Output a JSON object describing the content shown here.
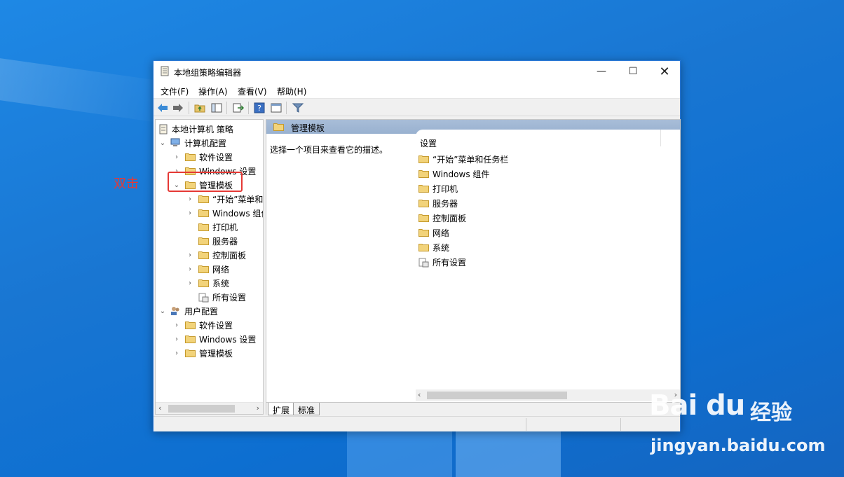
{
  "window": {
    "title": "本地组策略编辑器",
    "controls": {
      "minimize": "—",
      "maximize": "☐",
      "close": "✕"
    }
  },
  "menu": [
    "文件(F)",
    "操作(A)",
    "查看(V)",
    "帮助(H)"
  ],
  "toolbar": {
    "icons": [
      "back-icon",
      "forward-icon",
      "up-folder-icon",
      "show-hide-tree-icon",
      "export-list-icon",
      "help-icon",
      "properties-icon",
      "filter-icon"
    ]
  },
  "tree": {
    "root": "本地计算机 策略",
    "computer_config": "计算机配置",
    "cc_software": "软件设置",
    "cc_windows": "Windows 设置",
    "cc_admin": "管理模板",
    "admin_children": [
      "“开始”菜单和",
      "Windows 组件",
      "打印机",
      "服务器",
      "控制面板",
      "网络",
      "系统",
      "所有设置"
    ],
    "user_config": "用户配置",
    "uc_software": "软件设置",
    "uc_windows": "Windows 设置",
    "uc_admin": "管理模板"
  },
  "right_pane": {
    "header": "管理模板",
    "description": "选择一个项目来查看它的描述。",
    "column": "设置",
    "items": [
      "“开始”菜单和任务栏",
      "Windows 组件",
      "打印机",
      "服务器",
      "控制面板",
      "网络",
      "系统",
      "所有设置"
    ]
  },
  "tabs": {
    "extended": "扩展",
    "standard": "标准"
  },
  "annotation": {
    "text": "双击",
    "color": "#e53935"
  },
  "watermark": {
    "logo": "Bai du",
    "brand_cn": "经验",
    "url": "jingyan.baidu.com"
  },
  "colors": {
    "accent": "#2b79d6",
    "header_bg": "#a8bdd8",
    "desktop": "#1976d2"
  }
}
